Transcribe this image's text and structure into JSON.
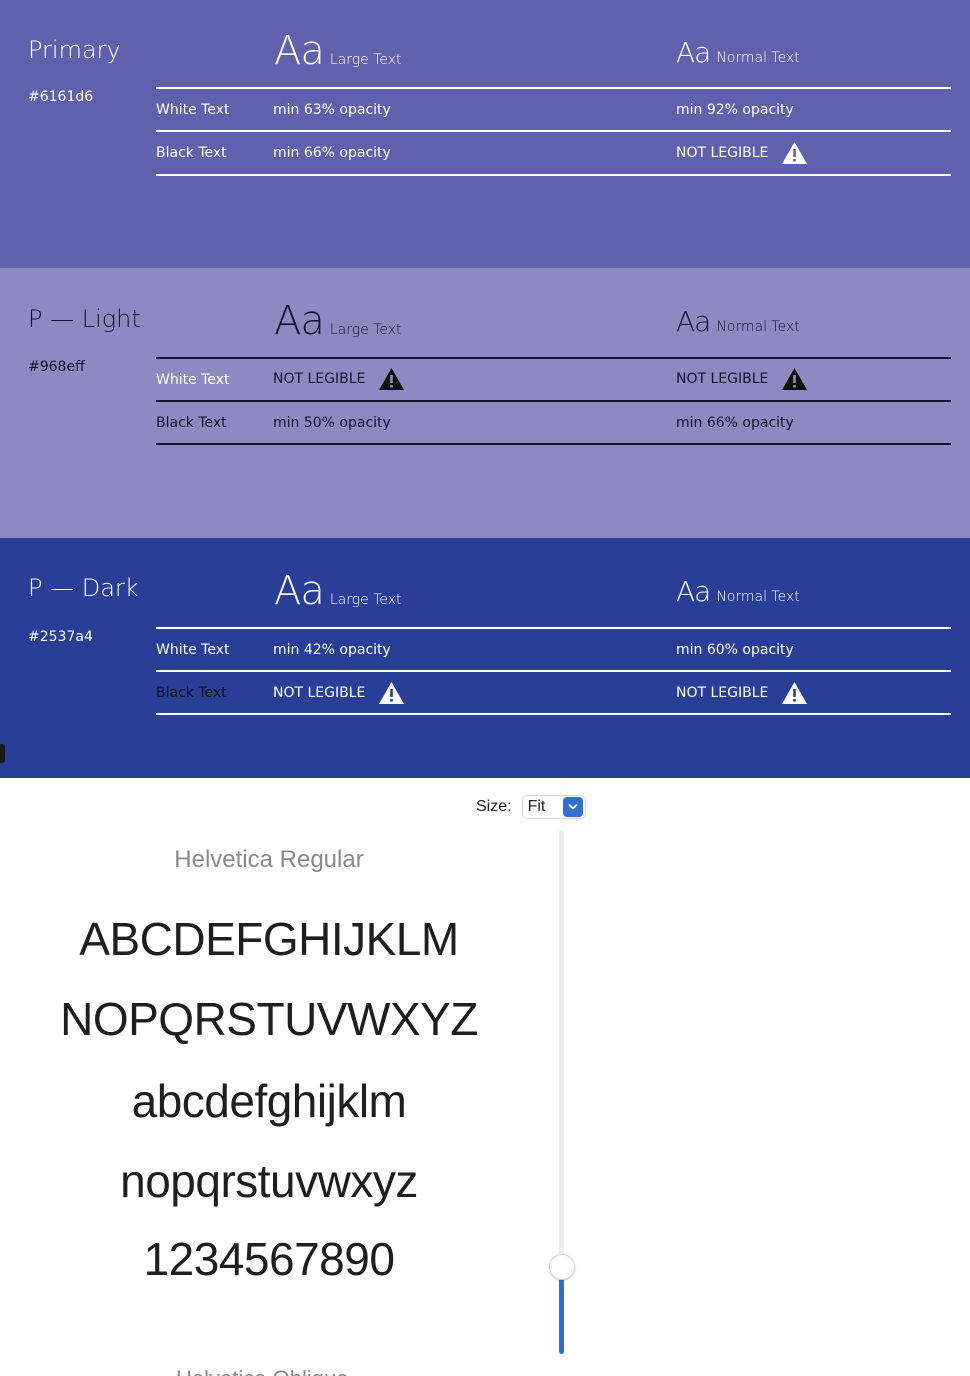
{
  "palettes": [
    {
      "name": "Primary",
      "hex": "#6161d6",
      "bg": "#6061ad",
      "fg": "#ffffff",
      "rule": "#ffffff",
      "large_text": "Large Text",
      "normal_text": "Normal Text",
      "aa": "Aa",
      "white_row": {
        "label": "White Text",
        "large": "min 63% opacity",
        "normal": "min 92% opacity"
      },
      "black_row": {
        "label": "Black Text",
        "large": "min 66% opacity",
        "normal": "NOT LEGIBLE"
      }
    },
    {
      "name": "P — Light",
      "hex": "#968eff",
      "bg": "#8d89c1",
      "fg": "#141432",
      "rule": "#141432",
      "large_text": "Large Text",
      "normal_text": "Normal Text",
      "aa": "Aa",
      "white_row": {
        "label": "White Text",
        "large": "NOT LEGIBLE",
        "normal": "NOT LEGIBLE"
      },
      "black_row": {
        "label": "Black Text",
        "large": "min 50% opacity",
        "normal": "min 66% opacity"
      }
    },
    {
      "name": "P — Dark",
      "hex": "#2537a4",
      "bg": "#283e97",
      "fg": "#ffffff",
      "rule": "#ffffff",
      "large_text": "Large Text",
      "normal_text": "Normal Text",
      "aa": "Aa",
      "white_row": {
        "label": "White Text",
        "large": "min 42% opacity",
        "normal": "min 60% opacity"
      },
      "black_row": {
        "label": "Black Text",
        "large": "NOT LEGIBLE",
        "normal": "NOT LEGIBLE"
      }
    }
  ],
  "font_preview": {
    "size_label": "Size:",
    "size_value": "Fit",
    "font_name": "Helvetica Regular",
    "next_font_name": "Helvetica Oblique",
    "samples": [
      "ABCDEFGHIJKLM",
      "NOPQRSTUVWXYZ",
      "abcdefghijklm",
      "nopqrstuvwxyz",
      "1234567890"
    ],
    "accent": "#2f6fd4",
    "slider_value": 0.85
  }
}
